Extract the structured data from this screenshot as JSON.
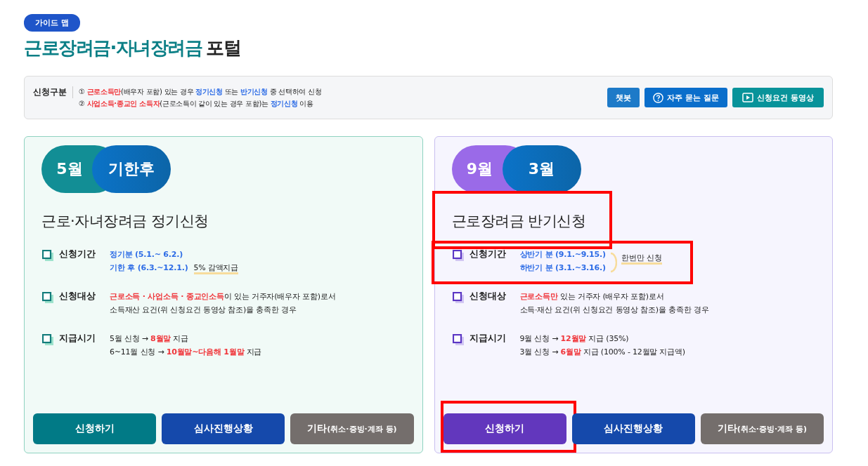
{
  "badge": "가이드 맵",
  "title": {
    "accent": "근로장려금·자녀장려금",
    "rest": "포털"
  },
  "notice": {
    "label": "신청구분",
    "lines": [
      [
        {
          "t": "① ",
          "kind": "plain"
        },
        {
          "t": "근로소득만",
          "kind": "red"
        },
        {
          "t": "(배우자 포함) 있는 경우 ",
          "kind": "plain"
        },
        {
          "t": "정기신청",
          "kind": "blue"
        },
        {
          "t": " 또는 ",
          "kind": "plain"
        },
        {
          "t": "반기신청",
          "kind": "blue"
        },
        {
          "t": " 중 선택하여 신청",
          "kind": "plain"
        }
      ],
      [
        {
          "t": "② ",
          "kind": "plain"
        },
        {
          "t": "사업소득·종교인 소득자",
          "kind": "red"
        },
        {
          "t": "(근로소득이 같이 있는 경우 포함)는 ",
          "kind": "plain"
        },
        {
          "t": "정기신청",
          "kind": "blue"
        },
        {
          "t": " 이용",
          "kind": "plain"
        }
      ]
    ],
    "buttons": [
      {
        "label": "챗봇",
        "kind": "plain"
      },
      {
        "label": "자주 묻는 질문",
        "kind": "help"
      },
      {
        "label": "신청요건 동영상",
        "kind": "video"
      }
    ]
  },
  "cards": [
    {
      "kind": "teal",
      "pills": [
        "5월",
        "기한후"
      ],
      "title": "근로·자녀장려금 정기신청",
      "title_highlighted": false,
      "rows": [
        {
          "label": "신청기간",
          "highlighted": false,
          "lines": [
            [
              {
                "t": "정기분 (5.1.~ 6.2.)",
                "kind": "blue"
              }
            ],
            [
              {
                "t": "기한 후 (6.3.~12.1.)",
                "kind": "blue"
              },
              {
                "t": "5% 감액지급",
                "kind": "mark"
              }
            ]
          ]
        },
        {
          "label": "신청대상",
          "highlighted": false,
          "lines": [
            [
              {
                "t": "근로소득 · 사업소득 · 종교인소득",
                "kind": "red"
              },
              {
                "t": "이 있는 거주자(배우자 포함)로서",
                "kind": "plain"
              }
            ],
            [
              {
                "t": "소득재산 요건(위 신청요건 동영상 참조)을 충족한 경우",
                "kind": "plain"
              }
            ]
          ]
        },
        {
          "label": "지급시기",
          "highlighted": false,
          "lines": [
            [
              {
                "t": "5월 신청 → ",
                "kind": "plain"
              },
              {
                "t": "8월말",
                "kind": "red"
              },
              {
                "t": " 지급",
                "kind": "plain"
              }
            ],
            [
              {
                "t": "6~11월 신청 → ",
                "kind": "plain"
              },
              {
                "t": "10월말~다음해 1월말",
                "kind": "red"
              },
              {
                "t": " 지급",
                "kind": "plain"
              }
            ]
          ]
        }
      ],
      "actions": [
        {
          "label": "신청하기",
          "kind": "apply",
          "highlighted": false
        },
        {
          "label": "심사진행상황",
          "kind": "status",
          "highlighted": false
        },
        {
          "label": "기타",
          "sub": "(취소·증빙·계좌 등)",
          "kind": "other",
          "highlighted": false
        }
      ]
    },
    {
      "kind": "purple",
      "pills": [
        "9월",
        "3월"
      ],
      "title": "근로장려금 반기신청",
      "title_highlighted": true,
      "rows": [
        {
          "label": "신청기간",
          "highlighted": true,
          "note": "한번만 신청",
          "lines": [
            [
              {
                "t": "상반기 분 (9.1.~9.15.)",
                "kind": "blue"
              }
            ],
            [
              {
                "t": "하반기 분 (3.1.~3.16.)",
                "kind": "blue"
              }
            ]
          ]
        },
        {
          "label": "신청대상",
          "highlighted": false,
          "lines": [
            [
              {
                "t": "근로소득만",
                "kind": "red"
              },
              {
                "t": " 있는 거주자 (배우자 포함)로서",
                "kind": "plain"
              }
            ],
            [
              {
                "t": "소득·재산 요건(위 신청요건 동영상 참조)을 충족한 경우",
                "kind": "plain"
              }
            ]
          ]
        },
        {
          "label": "지급시기",
          "highlighted": false,
          "lines": [
            [
              {
                "t": "9월 신청 → ",
                "kind": "plain"
              },
              {
                "t": "12월말",
                "kind": "red"
              },
              {
                "t": " 지급 (35%)",
                "kind": "plain"
              }
            ],
            [
              {
                "t": "3월 신청 → ",
                "kind": "plain"
              },
              {
                "t": "6월말",
                "kind": "red"
              },
              {
                "t": " 지급 (100% - 12월말 지급액)",
                "kind": "plain"
              }
            ]
          ]
        }
      ],
      "actions": [
        {
          "label": "신청하기",
          "kind": "apply",
          "highlighted": true
        },
        {
          "label": "심사진행상황",
          "kind": "status",
          "highlighted": false
        },
        {
          "label": "기타",
          "sub": "(취소·증빙·계좌 등)",
          "kind": "other",
          "highlighted": false
        }
      ]
    }
  ]
}
